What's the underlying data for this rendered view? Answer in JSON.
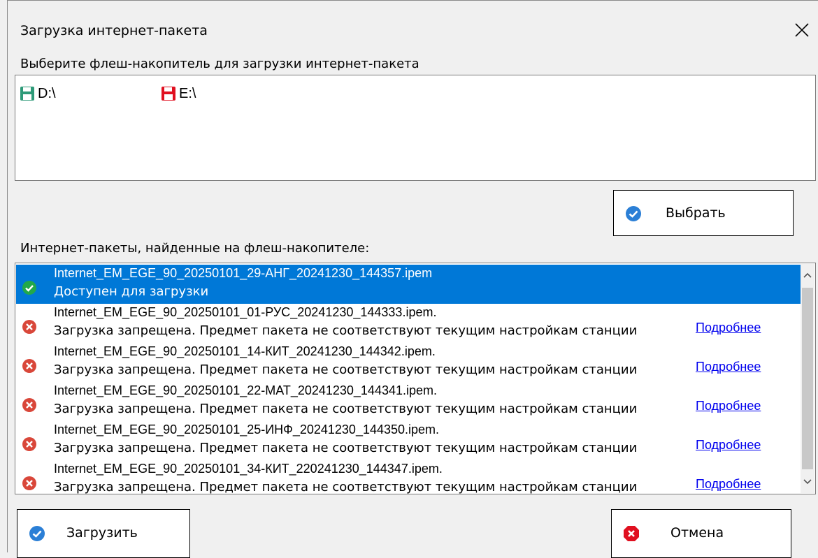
{
  "window": {
    "title": "Загрузка интернет-пакета"
  },
  "drives": {
    "label": "Выберите флеш-накопитель для загрузки интернет-пакета",
    "items": [
      {
        "label": "D:\\",
        "color": "#2e9a78"
      },
      {
        "label": "E:\\",
        "color": "#e01020"
      }
    ]
  },
  "select_button": {
    "label": "Выбрать"
  },
  "packages": {
    "label": "Интернет-пакеты, найденные на флеш-накопителе:",
    "more_label": "Подробнее",
    "rows": [
      {
        "name": "Internet_EM_EGE_90_20250101_29-АНГ_20241230_144357.ipem",
        "status": "Доступен для загрузки",
        "ok": true
      },
      {
        "name": "Internet_EM_EGE_90_20250101_01-РУС_20241230_144333.ipem.",
        "status": "Загрузка запрещена. Предмет пакета не соответствуют текущим настройкам станции",
        "ok": false
      },
      {
        "name": "Internet_EM_EGE_90_20250101_14-КИТ_20241230_144342.ipem.",
        "status": "Загрузка запрещена. Предмет пакета не соответствуют текущим настройкам станции",
        "ok": false
      },
      {
        "name": "Internet_EM_EGE_90_20250101_22-МАТ_20241230_144341.ipem.",
        "status": "Загрузка запрещена. Предмет пакета не соответствуют текущим настройкам станции",
        "ok": false
      },
      {
        "name": "Internet_EM_EGE_90_20250101_25-ИНФ_20241230_144350.ipem.",
        "status": "Загрузка запрещена. Предмет пакета не соответствуют текущим настройкам станции",
        "ok": false
      },
      {
        "name": "Internet_EM_EGE_90_20250101_34-КИТ_220241230_144347.ipem.",
        "status": "Загрузка запрещена. Предмет пакета не соответствуют текущим настройкам станции",
        "ok": false
      }
    ]
  },
  "load_button": {
    "label": "Загрузить"
  },
  "cancel_button": {
    "label": "Отмена"
  },
  "colors": {
    "selection": "#0078d7",
    "check": "#2b7fd6",
    "ok": "#22a84a",
    "error": "#d9473a",
    "link": "#0000ee"
  }
}
